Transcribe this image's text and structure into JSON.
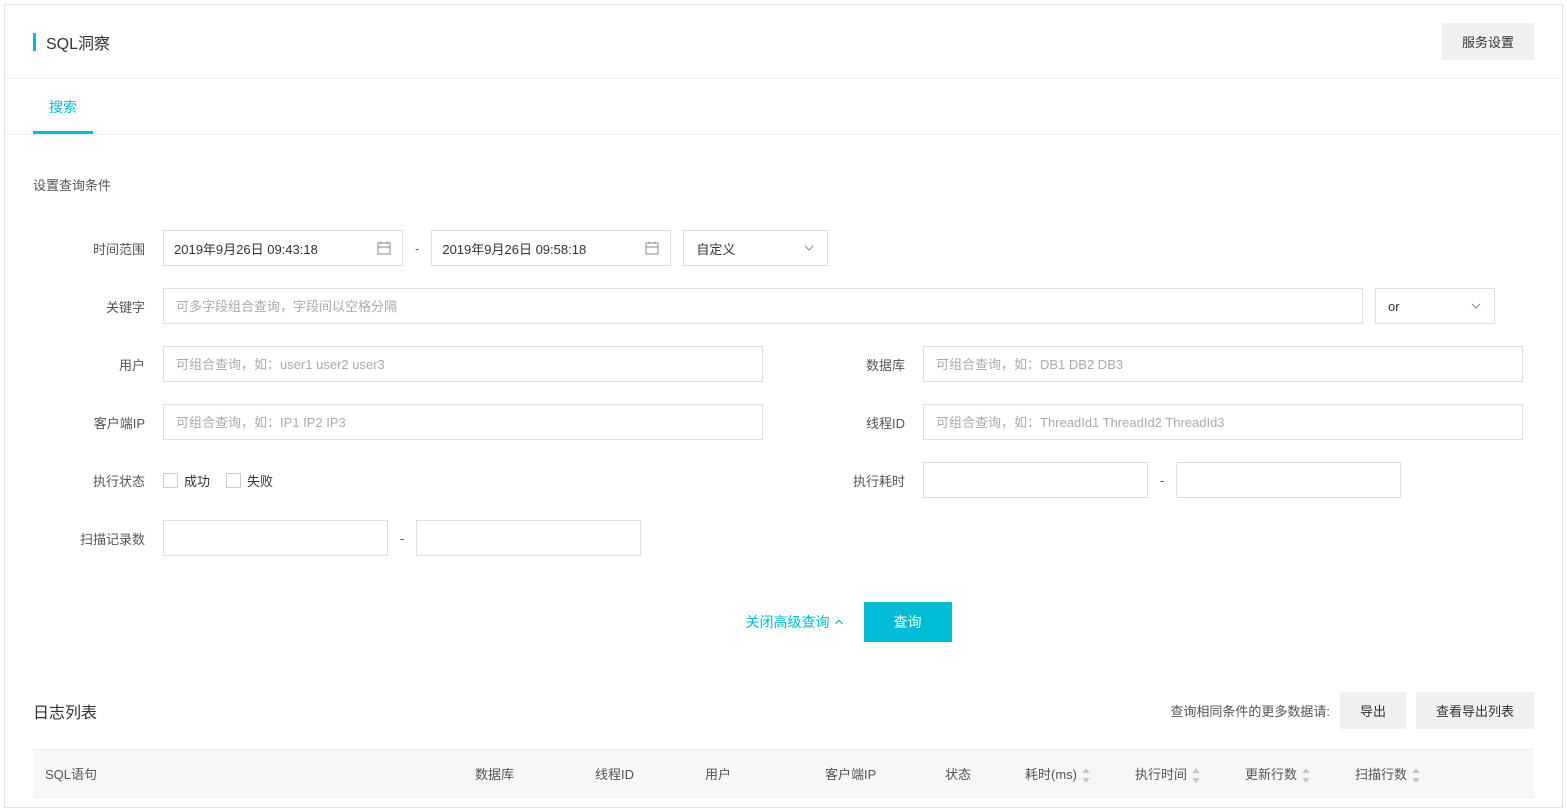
{
  "header": {
    "title": "SQL洞察",
    "settings_btn": "服务设置"
  },
  "tabs": {
    "search": "搜索"
  },
  "section": {
    "conditions_label": "设置查询条件"
  },
  "labels": {
    "time_range": "时间范围",
    "keyword": "关键字",
    "user": "用户",
    "database": "数据库",
    "client_ip": "客户端IP",
    "thread_id": "线程ID",
    "exec_status": "执行状态",
    "exec_time": "执行耗时",
    "scan_rows": "扫描记录数"
  },
  "time": {
    "from": "2019年9月26日 09:43:18",
    "to": "2019年9月26日 09:58:18",
    "preset": "自定义",
    "separator": "-"
  },
  "keyword": {
    "placeholder": "可多字段组合查询，字段间以空格分隔",
    "logic": "or"
  },
  "placeholders": {
    "user": "可组合查询，如：user1 user2 user3",
    "database": "可组合查询，如：DB1 DB2 DB3",
    "client_ip": "可组合查询，如：IP1 IP2 IP3",
    "thread_id": "可组合查询，如：ThreadId1 ThreadId2 ThreadId3"
  },
  "status": {
    "success": "成功",
    "fail": "失败"
  },
  "range_sep": "-",
  "actions": {
    "toggle": "关闭高级查询",
    "query": "查询"
  },
  "list": {
    "title": "日志列表",
    "more_hint": "查询相同条件的更多数据请:",
    "export": "导出",
    "view_export": "查看导出列表"
  },
  "columns": {
    "sql": "SQL语句",
    "database": "数据库",
    "thread_id": "线程ID",
    "user": "用户",
    "client_ip": "客户端IP",
    "status": "状态",
    "cost": "耗时(ms)",
    "exec_time": "执行时间",
    "update_rows": "更新行数",
    "scan_rows": "扫描行数"
  }
}
